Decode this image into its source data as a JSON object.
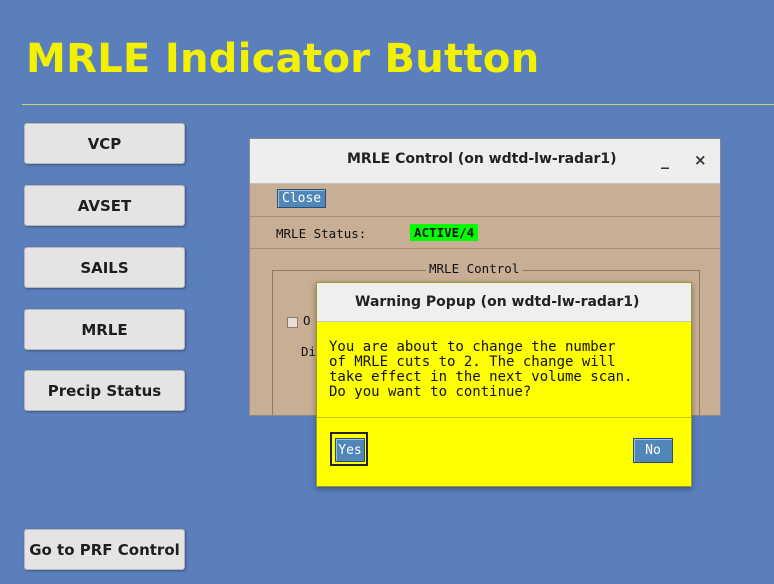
{
  "page": {
    "title": "MRLE Indicator Button"
  },
  "nav": {
    "vcp": "VCP",
    "avset": "AVSET",
    "sails": "SAILS",
    "mrle": "MRLE",
    "precip_status": "Precip Status",
    "prf_control": "Go to PRF Control"
  },
  "mrle_window": {
    "title": "MRLE Control (on wdtd-lw-radar1)",
    "minimize_glyph": "_",
    "close_glyph": "×",
    "close_button": "Close",
    "status_label": "MRLE Status:",
    "status_value": "ACTIVE/4",
    "group_label": "MRLE Control",
    "checkbox_partial": "O",
    "partial_text": "Di"
  },
  "warning_popup": {
    "title": "Warning Popup (on wdtd-lw-radar1)",
    "message": "You are about to change the number\nof MRLE cuts to 2. The change will\ntake effect in the next volume scan.\nDo you want to continue?",
    "yes": "Yes",
    "no": "No"
  },
  "colors": {
    "background": "#5b7fbd",
    "title": "#f2f200",
    "window_body": "#c8ae94",
    "status_active": "#00ff00",
    "popup_body": "#ffff00",
    "button_blue": "#5186b8"
  }
}
